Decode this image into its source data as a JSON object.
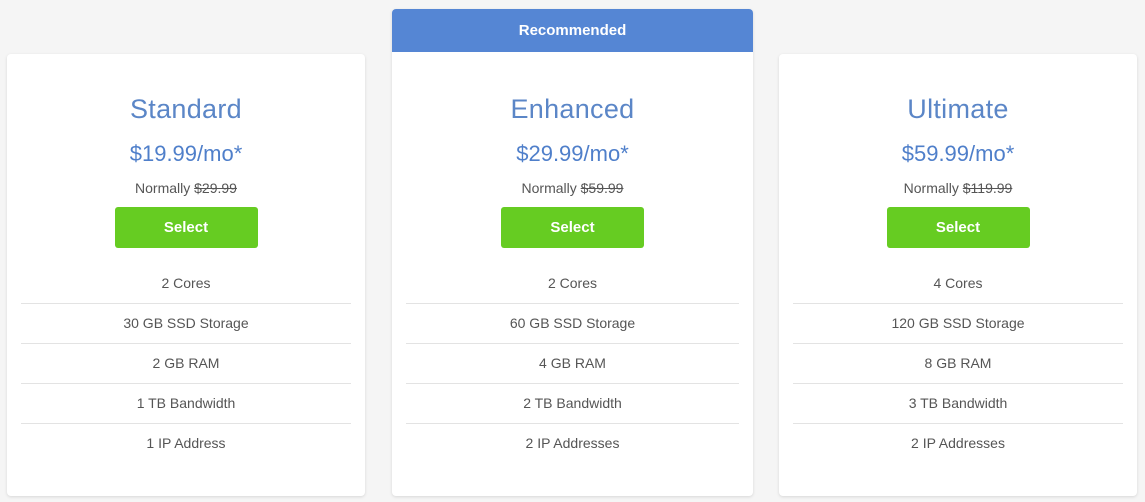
{
  "colors": {
    "accent_blue": "#5586d4",
    "plan_title": "#5b86c7",
    "select_green": "#66cc22",
    "background": "#f5f5f5"
  },
  "plans": [
    {
      "name": "Standard",
      "price": "$19.99/mo*",
      "normally_label": "Normally",
      "normal_price": "$29.99",
      "select_label": "Select",
      "features": [
        "2 Cores",
        "30 GB SSD Storage",
        "2 GB RAM",
        "1 TB Bandwidth",
        "1 IP Address"
      ]
    },
    {
      "badge": "Recommended",
      "name": "Enhanced",
      "price": "$29.99/mo*",
      "normally_label": "Normally",
      "normal_price": "$59.99",
      "select_label": "Select",
      "features": [
        "2 Cores",
        "60 GB SSD Storage",
        "4 GB RAM",
        "2 TB Bandwidth",
        "2 IP Addresses"
      ]
    },
    {
      "name": "Ultimate",
      "price": "$59.99/mo*",
      "normally_label": "Normally",
      "normal_price": "$119.99",
      "select_label": "Select",
      "features": [
        "4 Cores",
        "120 GB SSD Storage",
        "8 GB RAM",
        "3 TB Bandwidth",
        "2 IP Addresses"
      ]
    }
  ]
}
